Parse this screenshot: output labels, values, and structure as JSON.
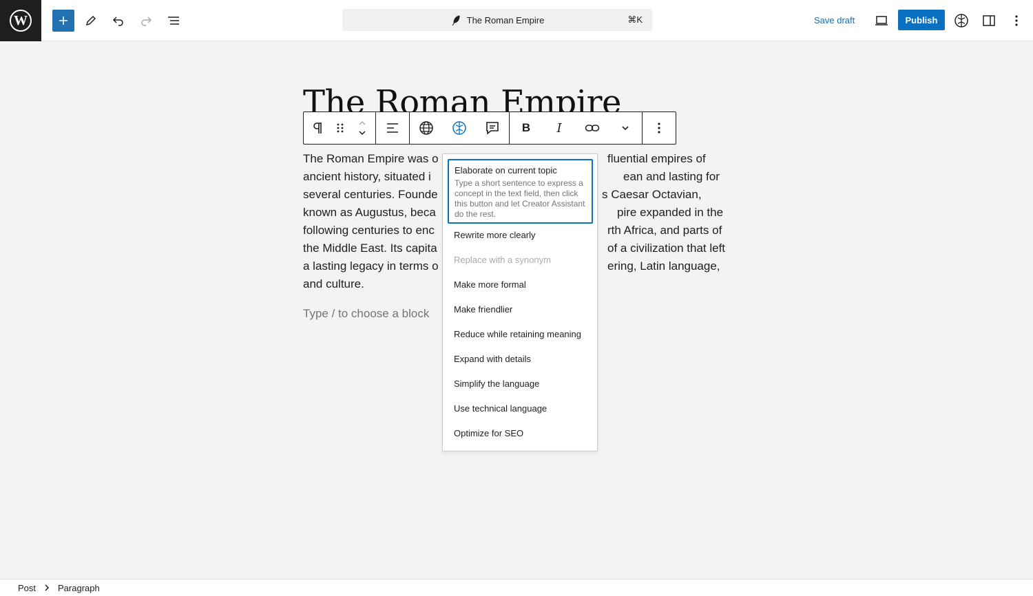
{
  "header": {
    "command_title": "The Roman Empire",
    "command_shortcut": "⌘K",
    "save_draft": "Save draft",
    "publish": "Publish"
  },
  "post": {
    "title": "The Roman Empire",
    "paragraph_lines": [
      "The Roman Empire was o",
      "ancient history, situated i",
      "several centuries. Founde",
      "known as Augustus, beca",
      "following centuries to enc",
      "the Middle East. Its capita",
      "a lasting legacy in terms o",
      "and culture."
    ],
    "paragraph_right_lines": [
      "fluential empires of",
      "ean and lasting for",
      "s Caesar Octavian,",
      "pire expanded in the",
      "rth Africa, and parts of",
      "of a civilization that left",
      "ering, Latin language,",
      ""
    ],
    "placeholder": "Type / to choose a block"
  },
  "ai_menu": {
    "first_item": {
      "title": "Elaborate on current topic",
      "description": "Type a short sentence to express a concept in the text field, then click this button and let Creator Assistant do the rest."
    },
    "items": [
      {
        "label": "Rewrite more clearly",
        "disabled": false
      },
      {
        "label": "Replace with a synonym",
        "disabled": true
      },
      {
        "label": "Make more formal",
        "disabled": false
      },
      {
        "label": "Make friendlier",
        "disabled": false
      },
      {
        "label": "Reduce while retaining meaning",
        "disabled": false
      },
      {
        "label": "Expand with details",
        "disabled": false
      },
      {
        "label": "Simplify the language",
        "disabled": false
      },
      {
        "label": "Use technical language",
        "disabled": false
      },
      {
        "label": "Optimize for SEO",
        "disabled": false
      }
    ]
  },
  "breadcrumb": {
    "items": [
      "Post",
      "Paragraph"
    ]
  },
  "colors": {
    "accent": "#0a70c0",
    "dark": "#1e1e1e"
  }
}
